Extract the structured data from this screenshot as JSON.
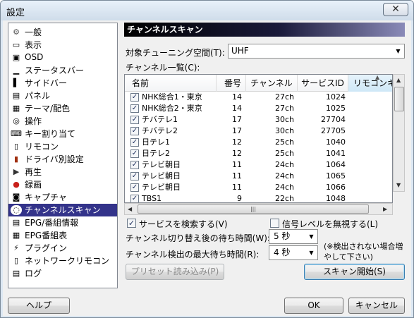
{
  "window": {
    "title": "設定",
    "close_label": "✕"
  },
  "sidebar": {
    "items": [
      {
        "label": "一般",
        "icon": "gear-icon"
      },
      {
        "label": "表示",
        "icon": "window-icon"
      },
      {
        "label": "OSD",
        "icon": "osd-icon"
      },
      {
        "label": "ステータスバー",
        "icon": "statusbar-icon"
      },
      {
        "label": "サイドバー",
        "icon": "sidebar-icon"
      },
      {
        "label": "パネル",
        "icon": "panel-icon"
      },
      {
        "label": "テーマ/配色",
        "icon": "grid-icon"
      },
      {
        "label": "操作",
        "icon": "mouse-icon"
      },
      {
        "label": "キー割り当て",
        "icon": "keyboard-icon"
      },
      {
        "label": "リモコン",
        "icon": "remote-icon"
      },
      {
        "label": "ドライバ別設定",
        "icon": "driver-icon"
      },
      {
        "label": "再生",
        "icon": "play-icon"
      },
      {
        "label": "録画",
        "icon": "record-icon"
      },
      {
        "label": "キャプチャ",
        "icon": "camera-icon"
      },
      {
        "label": "チャンネルスキャン",
        "icon": "scan-icon"
      },
      {
        "label": "EPG/番組情報",
        "icon": "epg-icon"
      },
      {
        "label": "EPG番組表",
        "icon": "program-guide-icon"
      },
      {
        "label": "プラグイン",
        "icon": "plugin-icon"
      },
      {
        "label": "ネットワークリモコン",
        "icon": "network-remote-icon"
      },
      {
        "label": "ログ",
        "icon": "log-icon"
      }
    ],
    "selected_index": 14
  },
  "panel": {
    "header": "チャンネルスキャン",
    "tuning_space_label": "対象チューニング空間(T):",
    "tuning_space_value": "UHF",
    "channel_list_label": "チャンネル一覧(C):",
    "columns": [
      "名前",
      "番号",
      "チャンネル",
      "サービスID",
      "リモコンキ"
    ],
    "rows": [
      {
        "checked": true,
        "name": "NHK総合1・東京",
        "number": "14",
        "channel": "27ch",
        "service_id": "1024"
      },
      {
        "checked": true,
        "name": "NHK総合2・東京",
        "number": "14",
        "channel": "27ch",
        "service_id": "1025"
      },
      {
        "checked": true,
        "name": "チバテレ1",
        "number": "17",
        "channel": "30ch",
        "service_id": "27704"
      },
      {
        "checked": true,
        "name": "チバテレ2",
        "number": "17",
        "channel": "30ch",
        "service_id": "27705"
      },
      {
        "checked": true,
        "name": "日テレ1",
        "number": "12",
        "channel": "25ch",
        "service_id": "1040"
      },
      {
        "checked": true,
        "name": "日テレ2",
        "number": "12",
        "channel": "25ch",
        "service_id": "1041"
      },
      {
        "checked": true,
        "name": "テレビ朝日",
        "number": "11",
        "channel": "24ch",
        "service_id": "1064"
      },
      {
        "checked": true,
        "name": "テレビ朝日",
        "number": "11",
        "channel": "24ch",
        "service_id": "1065"
      },
      {
        "checked": true,
        "name": "テレビ朝日",
        "number": "11",
        "channel": "24ch",
        "service_id": "1066"
      },
      {
        "checked": true,
        "name": "TBS1",
        "number": "9",
        "channel": "22ch",
        "service_id": "1048"
      }
    ],
    "search_services_label": "サービスを検索する(V)",
    "search_services_checked": true,
    "ignore_signal_label": "信号レベルを無視する(L)",
    "ignore_signal_checked": false,
    "wait_label": "チャンネル切り替え後の待ち時間(W):",
    "wait_value": "5 秒",
    "max_wait_label": "チャンネル検出の最大待ち時間(R):",
    "max_wait_value": "4 秒",
    "note": "(※検出されない場合増やして下さい)",
    "preset_button": "プリセット読み込み(P)",
    "scan_button": "スキャン開始(S)"
  },
  "footer": {
    "help": "ヘルプ",
    "ok": "OK",
    "cancel": "キャンセル"
  }
}
